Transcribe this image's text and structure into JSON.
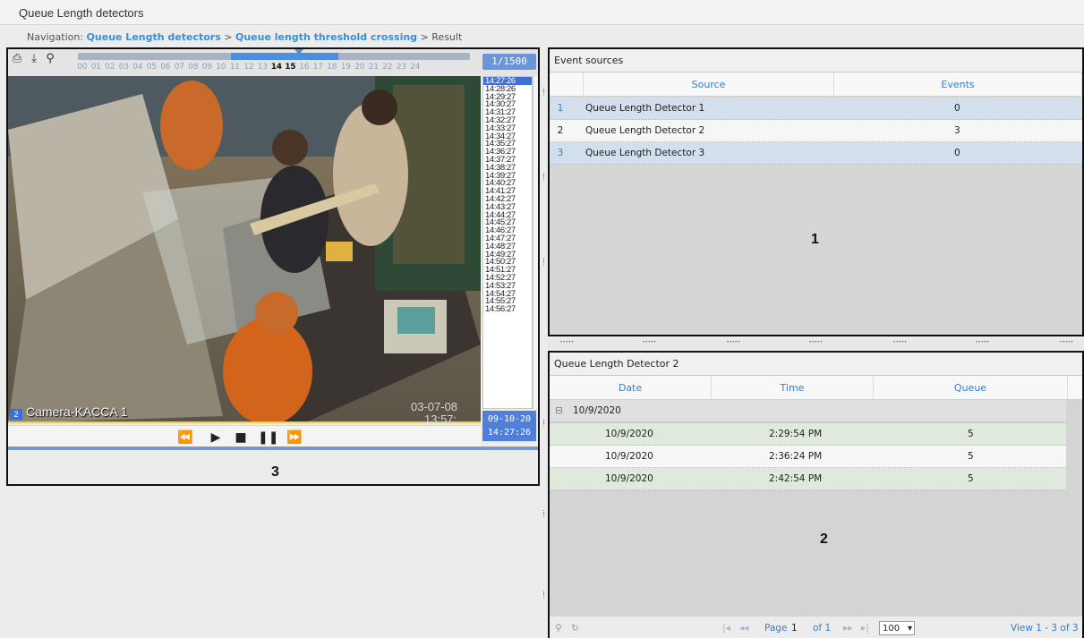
{
  "window": {
    "title": "Queue Length detectors"
  },
  "navigation": {
    "label": "Navigation:",
    "crumbs": [
      "Queue Length detectors",
      "Queue length threshold crossing"
    ],
    "sep": ">",
    "current": "Result"
  },
  "video": {
    "toolbar": {
      "icons": [
        "printer-icon",
        "download-icon",
        "search-icon"
      ]
    },
    "hours": [
      "00",
      "01",
      "02",
      "03",
      "04",
      "05",
      "06",
      "07",
      "08",
      "09",
      "10",
      "11",
      "12",
      "13",
      "14",
      "15",
      "16",
      "17",
      "18",
      "19",
      "20",
      "21",
      "22",
      "23",
      "24"
    ],
    "active_hours": [
      "14",
      "15"
    ],
    "counter": "1/1500",
    "times": [
      "14:27:26",
      "14:28:26",
      "14:29:27",
      "14:30:27",
      "14:31:27",
      "14:32:27",
      "14:33:27",
      "14:34:27",
      "14:35:27",
      "14:36:27",
      "14:37:27",
      "14:38:27",
      "14:39:27",
      "14:40:27",
      "14:41:27",
      "14:42:27",
      "14:43:27",
      "14:44:27",
      "14:45:27",
      "14:46:27",
      "14:47:27",
      "14:48:27",
      "14:49:27",
      "14:50:27",
      "14:51:27",
      "14:52:27",
      "14:53:27",
      "14:54:27",
      "14:55:27",
      "14:56:27"
    ],
    "selected_time": "14:27:26",
    "date_box": {
      "date": "09-10-20",
      "time": "14:27:26"
    },
    "camera": {
      "number": "2",
      "name": "Camera-KACCA 1"
    },
    "osd": {
      "date": "03-07-08",
      "time": "13:57:"
    },
    "controls": [
      "rewind-icon",
      "play-icon",
      "stop-icon",
      "pause-icon",
      "fast-forward-icon"
    ],
    "panel_number": "3"
  },
  "events": {
    "caption": "Event sources",
    "columns": [
      "Source",
      "Events"
    ],
    "rows": [
      {
        "n": "1",
        "source": "Queue Length Detector 1",
        "events": "0"
      },
      {
        "n": "2",
        "source": "Queue Length Detector 2",
        "events": "3"
      },
      {
        "n": "3",
        "source": "Queue Length Detector 3",
        "events": "0"
      }
    ],
    "panel_number": "1"
  },
  "detector": {
    "caption": "Queue Length Detector 2",
    "columns": [
      "Date",
      "Time",
      "Queue"
    ],
    "group": "10/9/2020",
    "rows": [
      {
        "date": "10/9/2020",
        "time": "2:29:54 PM",
        "queue": "5"
      },
      {
        "date": "10/9/2020",
        "time": "2:36:24 PM",
        "queue": "5"
      },
      {
        "date": "10/9/2020",
        "time": "2:42:54 PM",
        "queue": "5"
      }
    ],
    "panel_number": "2",
    "pager": {
      "page_label": "Page",
      "page": "1",
      "of_label": "of 1",
      "page_size": "100",
      "view": "View 1 - 3 of 3"
    }
  }
}
